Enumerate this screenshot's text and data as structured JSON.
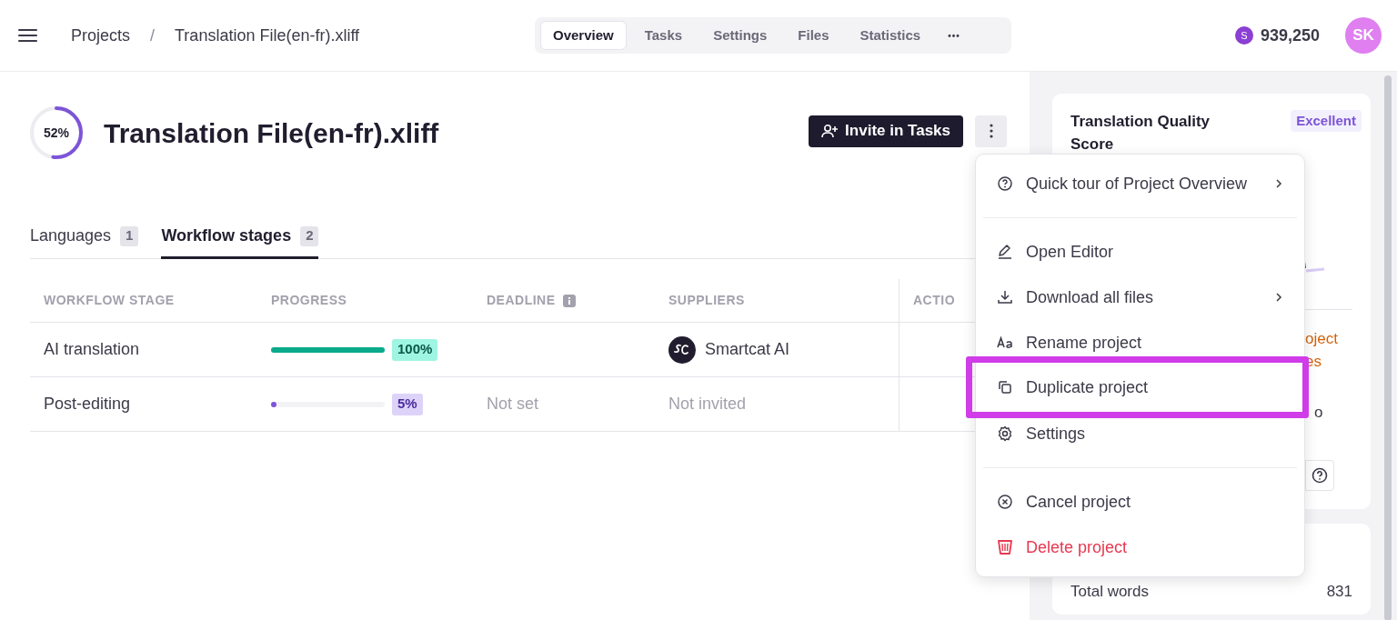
{
  "topbar": {
    "breadcrumbs": [
      "Projects",
      "Translation File(en-fr).xliff"
    ],
    "separator": "/",
    "nav_tabs": [
      {
        "label": "Overview",
        "selected": true
      },
      {
        "label": "Tasks",
        "selected": false
      },
      {
        "label": "Settings",
        "selected": false
      },
      {
        "label": "Files",
        "selected": false
      },
      {
        "label": "Statistics",
        "selected": false
      }
    ],
    "more": "•••",
    "balance": "939,250",
    "coin": "S",
    "avatar": "SK"
  },
  "project": {
    "progress_label": "52%",
    "level": 0.52,
    "title": "Translation File(en-fr).xliff",
    "invite_button": "Invite in Tasks"
  },
  "tabs": [
    {
      "label": "Languages",
      "count": "1",
      "selected": false
    },
    {
      "label": "Workflow stages",
      "count": "2",
      "selected": true
    }
  ],
  "table": {
    "columns": [
      "WORKFLOW STAGE",
      "PROGRESS",
      "DEADLINE",
      "SUPPLIERS",
      "ACTIO"
    ],
    "rows": [
      {
        "stage": "AI translation",
        "level": 1.0,
        "kind": "complete",
        "percent": "100%",
        "supplier": "Smartcat AI",
        "invited": true
      },
      {
        "stage": "Post-editing",
        "level": 0.05,
        "kind": "started",
        "percent": "5%",
        "deadline": "Not set",
        "supplier": "Not invited",
        "invited": false
      }
    ]
  },
  "side": {
    "title": "Translation Quality Score",
    "badge": "Excellent",
    "warning_fragments": [
      "oject",
      "es"
    ],
    "note_fragment": "o",
    "stats": [
      {
        "label": "Total words",
        "value": "831"
      }
    ]
  },
  "menu": {
    "groups": [
      [
        {
          "label": "Quick tour of Project Overview",
          "submenu": true,
          "danger": false,
          "highlighted": false
        }
      ],
      [
        {
          "label": "Open Editor",
          "submenu": false,
          "danger": false,
          "highlighted": false
        },
        {
          "label": "Download all files",
          "submenu": true,
          "danger": false,
          "highlighted": false
        },
        {
          "label": "Rename project",
          "submenu": false,
          "danger": false,
          "highlighted": false
        },
        {
          "label": "Duplicate project",
          "submenu": false,
          "danger": false,
          "highlighted": true
        },
        {
          "label": "Settings",
          "submenu": false,
          "danger": false,
          "highlighted": false
        }
      ],
      [
        {
          "label": "Cancel project",
          "submenu": false,
          "danger": false,
          "highlighted": false
        },
        {
          "label": "Delete project",
          "submenu": false,
          "danger": true,
          "highlighted": false
        }
      ]
    ]
  }
}
